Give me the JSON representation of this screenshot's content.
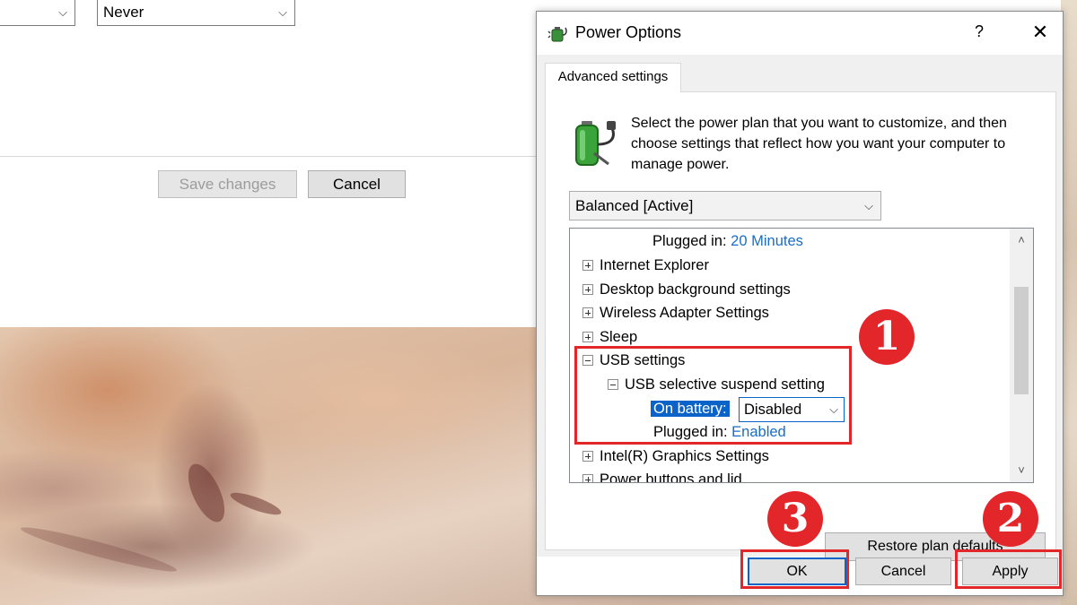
{
  "base_window": {
    "select_left_value": "",
    "select_right_value": "Never",
    "save_changes_label": "Save changes",
    "cancel_label": "Cancel"
  },
  "dialog": {
    "title": "Power Options",
    "help_glyph": "?",
    "close_glyph": "✕",
    "tab_label": "Advanced settings",
    "description": "Select the power plan that you want to customize, and then choose settings that reflect how you want your computer to manage power.",
    "plan_select_value": "Balanced [Active]",
    "tree": {
      "partial_label": "Plugged in:",
      "partial_value": "20 Minutes",
      "items": [
        "Internet Explorer",
        "Desktop background settings",
        "Wireless Adapter Settings",
        "Sleep"
      ],
      "usb_label": "USB settings",
      "usb_sub_label": "USB selective suspend setting",
      "on_battery_label": "On battery:",
      "on_battery_value": "Disabled",
      "plugged_in_label": "Plugged in:",
      "plugged_in_value": "Enabled",
      "after_items": [
        "Intel(R) Graphics Settings",
        "Power buttons and lid"
      ]
    },
    "restore_label": "Restore plan defaults",
    "ok_label": "OK",
    "cancel_label": "Cancel",
    "apply_label": "Apply"
  },
  "annotations": {
    "step1": "1",
    "step2": "2",
    "step3": "3",
    "color": "#e3262a"
  },
  "icons": [
    "chevron-down-icon",
    "power-options-icon",
    "battery-plug-icon",
    "plus-expander-icon",
    "minus-expander-icon",
    "scroll-up-icon",
    "scroll-down-icon"
  ]
}
